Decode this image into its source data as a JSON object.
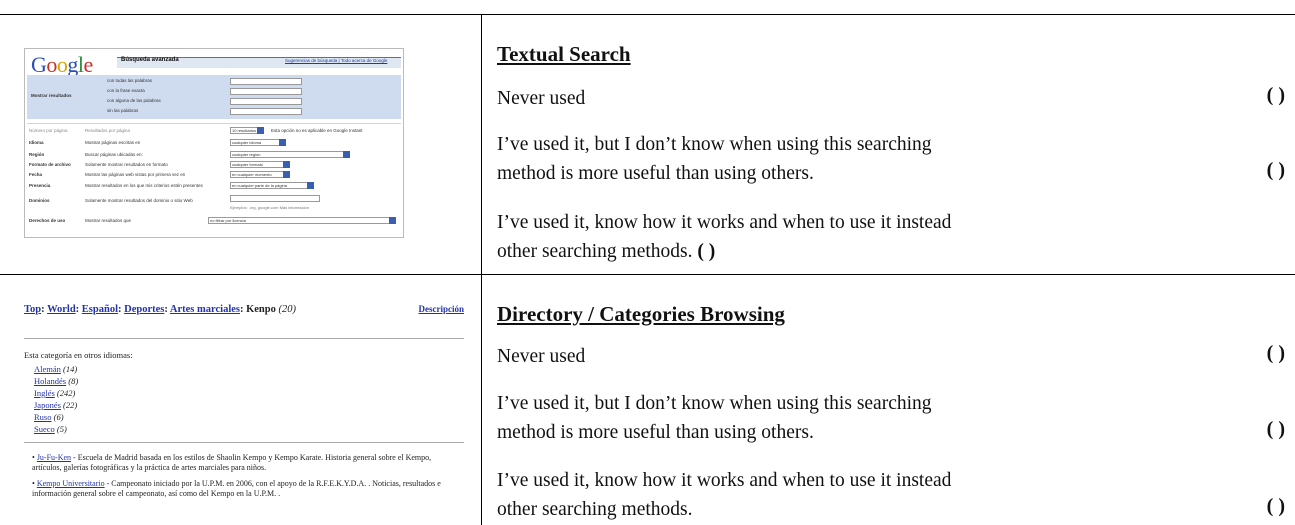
{
  "sections": [
    {
      "title": "Textual Search",
      "options": [
        {
          "label": "Never used",
          "mark": "( )"
        },
        {
          "label": "I’ve used it, but I don’t know when using this searching method is more useful than using others.",
          "line1": "I’ve used it, but I don’t know when using this searching",
          "line2": "method is more useful than using others.",
          "mark": "( )"
        },
        {
          "label": "I’ve used it, know how it works and when to use it instead other searching methods.",
          "line1": "I’ve used it, know how it works and when to use it instead",
          "line2": "other searching methods.",
          "mark": "( )"
        }
      ]
    },
    {
      "title": "Directory / Categories Browsing",
      "options": [
        {
          "label": "Never used",
          "mark": "( )"
        },
        {
          "label": "I’ve used it, but I don’t know when using this searching method is more useful than using others.",
          "line1": "I’ve used it, but I don’t know when using this searching",
          "line2": "method is more useful than using others.",
          "mark": "( )"
        },
        {
          "label": "I’ve used it, know how it works and when to use it instead other searching methods.",
          "line1": "I’ve used it, know how it works and when to use it instead",
          "line2": "other searching methods.",
          "mark": "( )"
        }
      ]
    }
  ],
  "google_thumb": {
    "logo": [
      "G",
      "o",
      "o",
      "g",
      "l",
      "e"
    ],
    "heading": "Búsqueda avanzada",
    "header_link": "Sugerencias de búsqueda | Todo acerca de Google",
    "show_results": "Mostrar resultados",
    "rows": [
      "con todas las palabras",
      "con la frase exacta",
      "con alguna de las palabras",
      "sin las palabras"
    ],
    "fields": [
      {
        "label": "Número por página",
        "text": "Resultados por página",
        "select": "10 resultados",
        "note": "Esta opción no es aplicable en Google Instant"
      },
      {
        "label": "Idioma",
        "text": "Mostrar páginas escritas en",
        "select": "cualquier idioma"
      },
      {
        "label": "Región",
        "text": "Buscar páginas ubicadas en:",
        "select": "cualquier región"
      },
      {
        "label": "Formato de archivo",
        "text": "Solamente  mostrar resultados en formato",
        "select": "cualquier formato"
      },
      {
        "label": "Fecha",
        "text": "Mostrar las páginas web vistas por primera vez en",
        "select": "en cualquier momento"
      },
      {
        "label": "Presencia",
        "text": "Mostrar resultados en los que mis criterios estén presentes",
        "select": "en cualquier parte de la página"
      },
      {
        "label": "Dominios",
        "text": "Solamente  mostrar resultados del dominio o sitio Web",
        "note": "Ejemplos: .org, google.com  Más información"
      },
      {
        "label": "Derechos de uso",
        "text": "Mostrar resultados que",
        "select": "no filtrar por licencia"
      }
    ]
  },
  "directory_thumb": {
    "crumbs": [
      "Top",
      "World",
      "Español",
      "Deportes",
      "Artes marciales"
    ],
    "current": "Kenpo",
    "count": "(20)",
    "description": "Descripción",
    "other_langs": "Esta categoría en otros idiomas:",
    "langs": [
      {
        "name": "Alemán",
        "count": "(14)"
      },
      {
        "name": "Holandés",
        "count": "(8)"
      },
      {
        "name": "Inglés",
        "count": "(242)"
      },
      {
        "name": "Japonés",
        "count": "(22)"
      },
      {
        "name": "Ruso",
        "count": "(6)"
      },
      {
        "name": "Sueco",
        "count": "(5)"
      }
    ],
    "entries": [
      {
        "name": "Ju-Fu-Ken",
        "text": " - Escuela de Madrid basada en los estilos de Shaolin Kempo y Kempo Karate. Historia general sobre el Kempo, artículos, galerías fotográficas y la práctica de artes marciales para niños."
      },
      {
        "name": "Kempo Universitario",
        "text": " - Campeonato iniciado por la U.P.M. en 2006, con el apoyo de la R.F.E.K.Y.D.A. . Noticias, resultados e información general sobre el campeonato, así como del Kempo en la U.P.M. ."
      }
    ]
  }
}
